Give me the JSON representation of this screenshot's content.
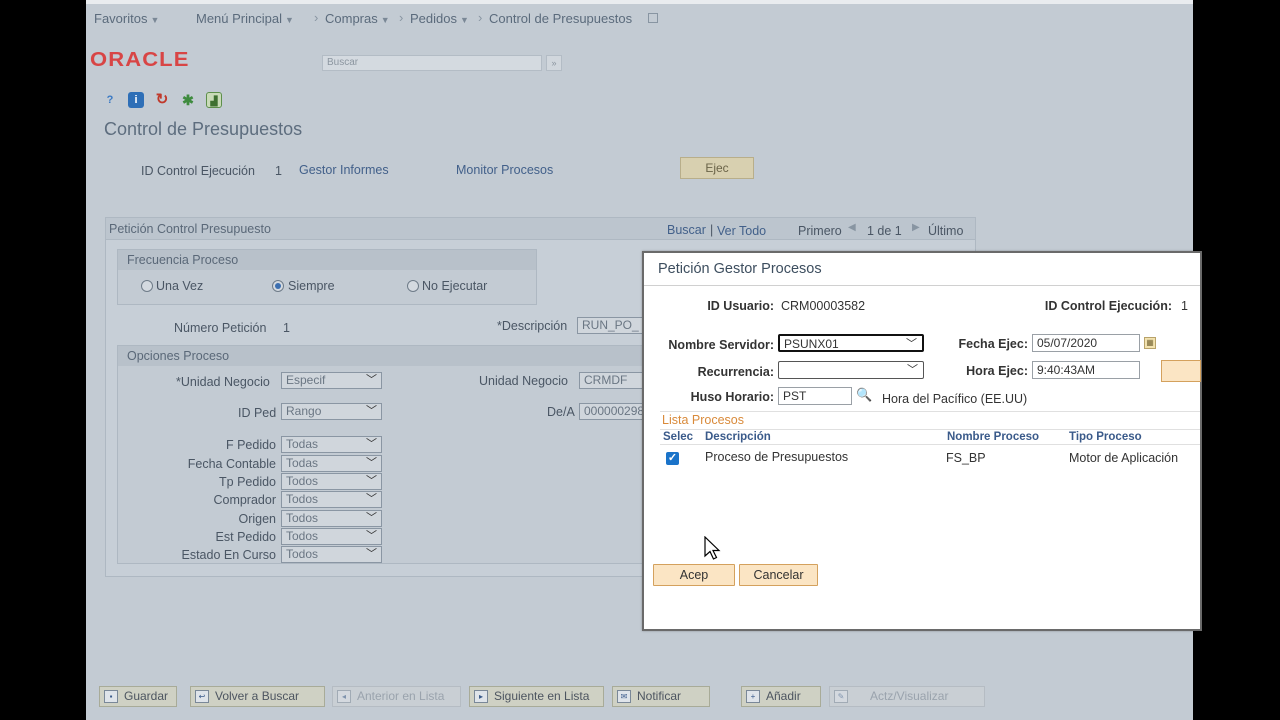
{
  "nav": {
    "favoritos": "Favoritos",
    "menu_principal": "Menú Principal",
    "compras": "Compras",
    "pedidos": "Pedidos",
    "control": "Control de Presupuestos"
  },
  "header": {
    "logo": "ORACLE",
    "search_placeholder": "Buscar"
  },
  "page": {
    "title": "Control de Presupuestos",
    "run_control_label": "ID Control Ejecución",
    "run_control_value": "1",
    "gestor_informes": "Gestor Informes",
    "monitor_procesos": "Monitor Procesos",
    "ejec_button": "Ejec"
  },
  "panel": {
    "title": "Petición Control Presupuesto",
    "buscar": "Buscar",
    "sep": "|",
    "ver_todo": "Ver Todo",
    "primero": "Primero",
    "pager": "1 de 1",
    "ultimo": "Último",
    "frecuencia": {
      "title": "Frecuencia Proceso",
      "options": [
        "Una Vez",
        "Siempre",
        "No Ejecutar"
      ],
      "selected": "Siempre"
    },
    "numero_peticion_label": "Número Petición",
    "numero_peticion_value": "1",
    "descripcion_label": "*Descripción",
    "descripcion_value": "RUN_PO_",
    "opciones": {
      "title": "Opciones Proceso",
      "unidad_negocio_req_label": "*Unidad Negocio",
      "unidad_negocio_req_value": "Especif",
      "unidad_negocio_label": "Unidad Negocio",
      "unidad_negocio_value": "CRMDF",
      "id_ped_label": "ID Ped",
      "id_ped_value": "Rango",
      "dea_label": "De/A",
      "dea_value": "000000298",
      "rows": [
        {
          "label": "F Pedido",
          "value": "Todas"
        },
        {
          "label": "Fecha Contable",
          "value": "Todas"
        },
        {
          "label": "Tp Pedido",
          "value": "Todos"
        },
        {
          "label": "Comprador",
          "value": "Todos"
        },
        {
          "label": "Origen",
          "value": "Todos"
        },
        {
          "label": "Est Pedido",
          "value": "Todos"
        },
        {
          "label": "Estado En Curso",
          "value": "Todos"
        }
      ]
    }
  },
  "dialog": {
    "title": "Petición Gestor Procesos",
    "id_usuario_label": "ID Usuario:",
    "id_usuario_value": "CRM00003582",
    "id_control_label": "ID Control Ejecución:",
    "id_control_value": "1",
    "servidor_label": "Nombre Servidor:",
    "servidor_value": "PSUNX01",
    "fecha_label": "Fecha Ejec:",
    "fecha_value": "05/07/2020",
    "recurrencia_label": "Recurrencia:",
    "recurrencia_value": "",
    "hora_label": "Hora Ejec:",
    "hora_value": "9:40:43AM",
    "huso_label": "Huso Horario:",
    "huso_value": "PST",
    "huso_desc": "Hora del Pacífico (EE.UU)",
    "lista_title": "Lista Procesos",
    "columns": [
      "Selec",
      "Descripción",
      "Nombre Proceso",
      "Tipo Proceso"
    ],
    "rows": [
      {
        "selected": true,
        "descripcion": "Proceso de Presupuestos",
        "nombre": "FS_BP",
        "tipo": "Motor de Aplicación"
      }
    ],
    "acep_button": "Acep",
    "cancelar_button": "Cancelar"
  },
  "toolbar": {
    "guardar": "Guardar",
    "volver": "Volver a Buscar",
    "anterior": "Anterior en Lista",
    "siguiente": "Siguiente en Lista",
    "notificar": "Notificar",
    "anadir": "Añadir",
    "actualizar": "Actz/Visualizar"
  },
  "colors": {
    "logo_red": "#d84545",
    "dialog_button": "#fbe5c4",
    "checkbox_blue": "#1a73c9",
    "list_title_orange": "#d98a3a"
  }
}
